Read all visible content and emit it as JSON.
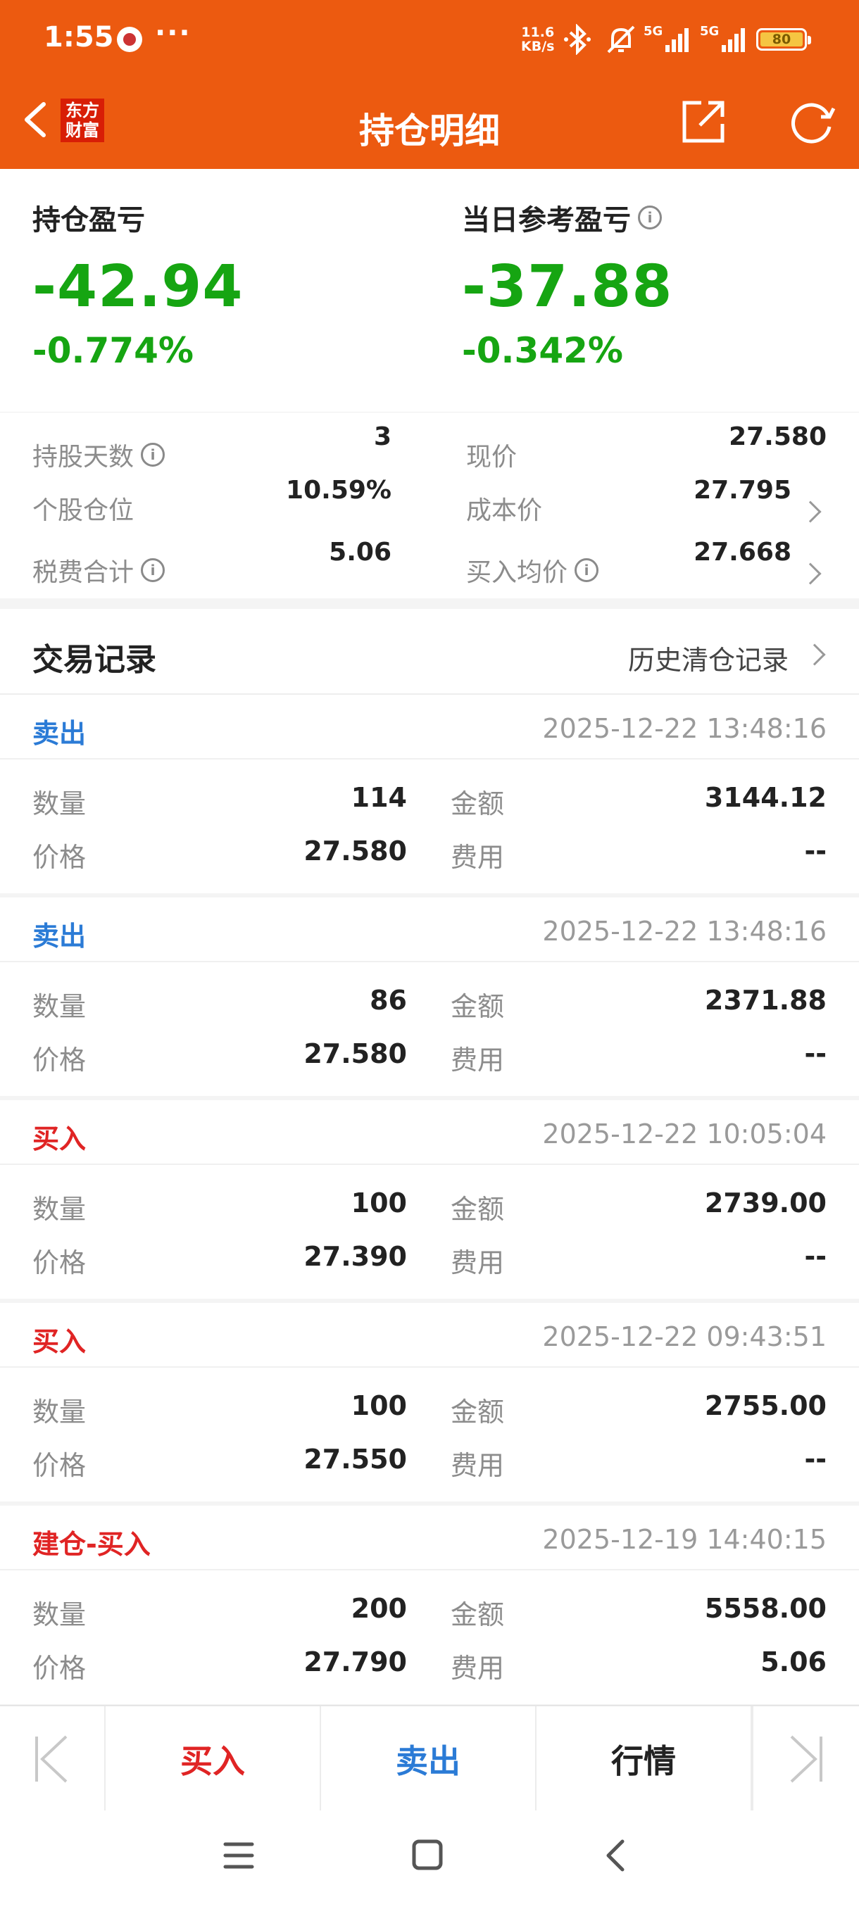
{
  "status_bar": {
    "time": "1:55",
    "dots": "···",
    "net_speed_top": "11.6",
    "net_speed_bottom": "KB/s",
    "sig1": "5G",
    "sig2": "5G",
    "battery": "80"
  },
  "header": {
    "title": "持仓明细",
    "logo_line1": "东方",
    "logo_line2": "财富"
  },
  "summary": {
    "position_pl_label": "持仓盈亏",
    "position_pl_value": "-42.94",
    "position_pl_pct": "-0.774%",
    "daily_pl_label": "当日参考盈亏",
    "daily_pl_value": "-37.88",
    "daily_pl_pct": "-0.342%"
  },
  "stats": {
    "hold_days_label": "持股天数",
    "hold_days": "3",
    "current_price_label": "现价",
    "current_price": "27.580",
    "position_ratio_label": "个股仓位",
    "position_ratio": "10.59%",
    "cost_price_label": "成本价",
    "cost_price": "27.795",
    "tax_fee_label": "税费合计",
    "tax_fee": "5.06",
    "avg_buy_label": "买入均价",
    "avg_buy": "27.668"
  },
  "records": {
    "title": "交易记录",
    "history_link": "历史清仓记录",
    "labels": {
      "qty": "数量",
      "amount": "金额",
      "price": "价格",
      "fee": "费用"
    },
    "items": [
      {
        "type": "卖出",
        "kind": "sell",
        "time": "2025-12-22 13:48:16",
        "qty": "114",
        "amount": "3144.12",
        "price": "27.580",
        "fee": "--"
      },
      {
        "type": "卖出",
        "kind": "sell",
        "time": "2025-12-22 13:48:16",
        "qty": "86",
        "amount": "2371.88",
        "price": "27.580",
        "fee": "--"
      },
      {
        "type": "买入",
        "kind": "buy",
        "time": "2025-12-22 10:05:04",
        "qty": "100",
        "amount": "2739.00",
        "price": "27.390",
        "fee": "--"
      },
      {
        "type": "买入",
        "kind": "buy",
        "time": "2025-12-22 09:43:51",
        "qty": "100",
        "amount": "2755.00",
        "price": "27.550",
        "fee": "--"
      },
      {
        "type": "建仓-买入",
        "kind": "buy",
        "time": "2025-12-19 14:40:15",
        "qty": "200",
        "amount": "5558.00",
        "price": "27.790",
        "fee": "5.06"
      }
    ]
  },
  "bottom_bar": {
    "buy": "买入",
    "sell": "卖出",
    "quote": "行情"
  },
  "colors": {
    "brand_orange": "#ec5a10",
    "loss_green": "#16a512",
    "buy_red": "#e02424",
    "sell_blue": "#2b7bd6"
  }
}
